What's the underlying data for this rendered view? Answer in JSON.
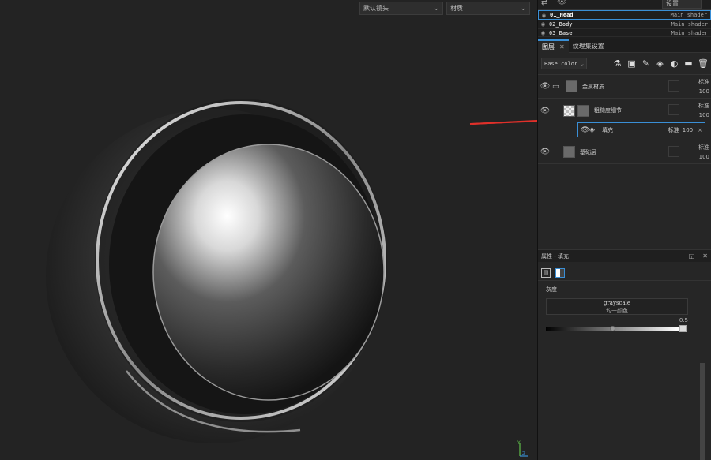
{
  "viewport": {
    "camera_select": "默认镜头",
    "view_select": "材质",
    "axis": {
      "y": "Y",
      "z": "Z"
    }
  },
  "top_strip": {
    "settings_label": "设置"
  },
  "texture_sets": [
    {
      "name": "01_Head",
      "shader": "Main shader",
      "active": true
    },
    {
      "name": "02_Body",
      "shader": "Main shader",
      "active": false
    },
    {
      "name": "03_Base",
      "shader": "Main shader",
      "active": false
    }
  ],
  "tabs": {
    "layers": "图层",
    "close": "✕",
    "texture_set_settings": "纹理集设置"
  },
  "toolbar": {
    "channel": "Base color"
  },
  "layers": [
    {
      "name": "金属材质",
      "blend": "标准",
      "opacity": "100"
    },
    {
      "name": "粗糙度细节",
      "blend": "标准",
      "opacity": "100"
    },
    {
      "name": "基础层",
      "blend": "标准",
      "opacity": "100"
    }
  ],
  "fill_effect": {
    "name": "填充",
    "blend": "标准",
    "opacity": "100",
    "close": "×"
  },
  "properties": {
    "title": "属性 - 填充",
    "section_label": "灰度",
    "grayscale_title": "grayscale",
    "grayscale_sub": "均一颜色",
    "grayscale_value": "0.5",
    "slider_fraction": 0.5
  },
  "colors": {
    "accent": "#3a8fd6",
    "arrow": "#e0302a"
  }
}
